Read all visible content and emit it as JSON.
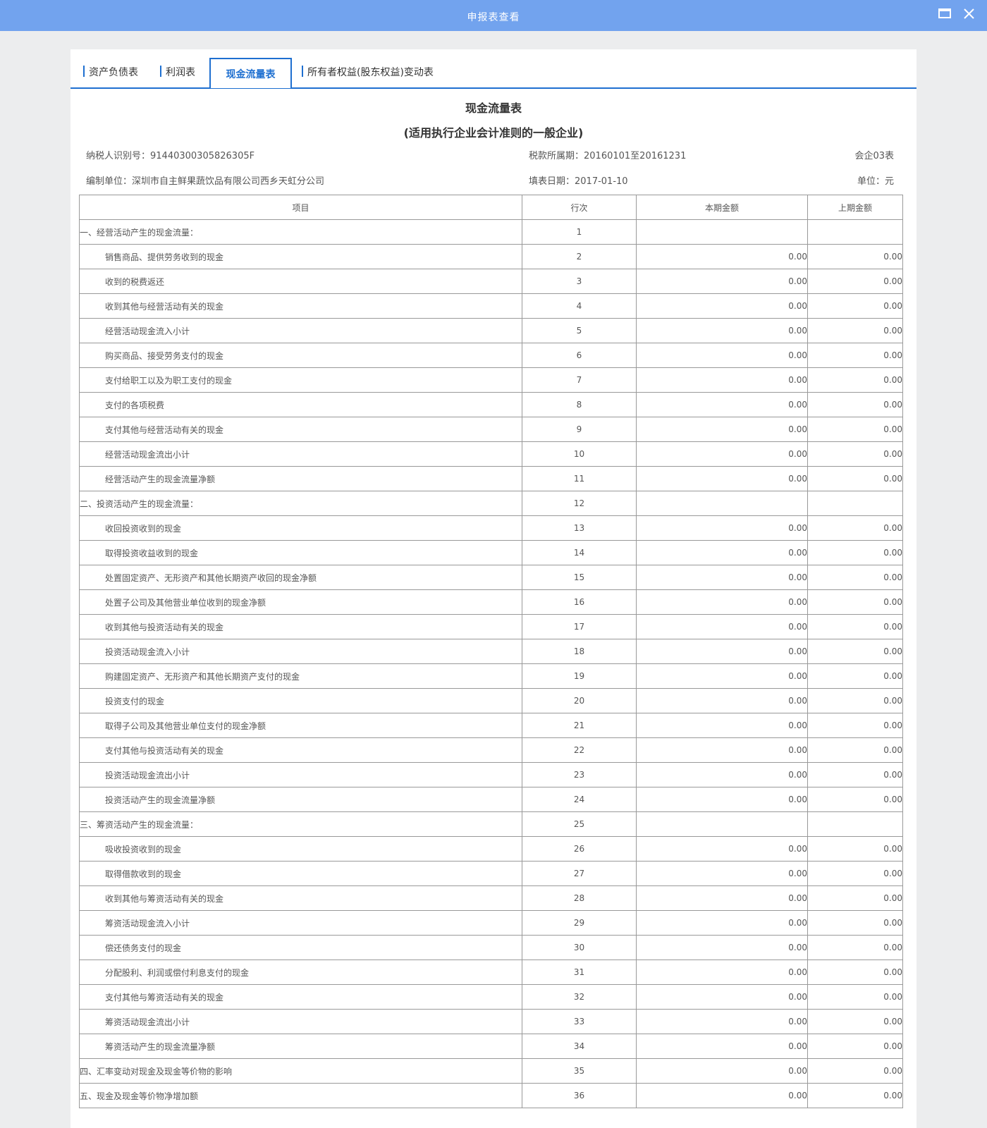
{
  "window": {
    "title": "申报表查看"
  },
  "tabs": [
    {
      "label": "资产负债表"
    },
    {
      "label": "利润表"
    },
    {
      "label": "现金流量表"
    },
    {
      "label": "所有者权益(股东权益)变动表"
    }
  ],
  "report": {
    "title": "现金流量表",
    "subtitle": "(适用执行企业会计准则的一般企业)",
    "taxpayer_id": "纳税人识别号：91440300305826305F",
    "period": "税款所属期：20160101至20161231",
    "form_code": "会企03表",
    "org": "编制单位：深圳市自主鲜果蔬饮品有限公司西乡天虹分公司",
    "fill_date": "填表日期：2017-01-10",
    "unit": "单位：元"
  },
  "table": {
    "headers": {
      "item": "项目",
      "line": "行次",
      "current": "本期金额",
      "previous": "上期金额"
    },
    "rows": [
      {
        "item": "一、经营活动产生的现金流量：",
        "line": "1",
        "current": "",
        "previous": "",
        "section": true
      },
      {
        "item": "销售商品、提供劳务收到的现金",
        "line": "2",
        "current": "0.00",
        "previous": "0.00"
      },
      {
        "item": "收到的税费返还",
        "line": "3",
        "current": "0.00",
        "previous": "0.00"
      },
      {
        "item": "收到其他与经营活动有关的现金",
        "line": "4",
        "current": "0.00",
        "previous": "0.00"
      },
      {
        "item": "经营活动现金流入小计",
        "line": "5",
        "current": "0.00",
        "previous": "0.00"
      },
      {
        "item": "购买商品、接受劳务支付的现金",
        "line": "6",
        "current": "0.00",
        "previous": "0.00"
      },
      {
        "item": "支付给职工以及为职工支付的现金",
        "line": "7",
        "current": "0.00",
        "previous": "0.00"
      },
      {
        "item": "支付的各项税费",
        "line": "8",
        "current": "0.00",
        "previous": "0.00"
      },
      {
        "item": "支付其他与经营活动有关的现金",
        "line": "9",
        "current": "0.00",
        "previous": "0.00"
      },
      {
        "item": "经营活动现金流出小计",
        "line": "10",
        "current": "0.00",
        "previous": "0.00"
      },
      {
        "item": "经营活动产生的现金流量净额",
        "line": "11",
        "current": "0.00",
        "previous": "0.00"
      },
      {
        "item": "二、投资活动产生的现金流量：",
        "line": "12",
        "current": "",
        "previous": "",
        "section": true
      },
      {
        "item": "收回投资收到的现金",
        "line": "13",
        "current": "0.00",
        "previous": "0.00"
      },
      {
        "item": "取得投资收益收到的现金",
        "line": "14",
        "current": "0.00",
        "previous": "0.00"
      },
      {
        "item": "处置固定资产、无形资产和其他长期资产收回的现金净额",
        "line": "15",
        "current": "0.00",
        "previous": "0.00"
      },
      {
        "item": "处置子公司及其他营业单位收到的现金净额",
        "line": "16",
        "current": "0.00",
        "previous": "0.00"
      },
      {
        "item": "收到其他与投资活动有关的现金",
        "line": "17",
        "current": "0.00",
        "previous": "0.00"
      },
      {
        "item": "投资活动现金流入小计",
        "line": "18",
        "current": "0.00",
        "previous": "0.00"
      },
      {
        "item": "购建固定资产、无形资产和其他长期资产支付的现金",
        "line": "19",
        "current": "0.00",
        "previous": "0.00"
      },
      {
        "item": "投资支付的现金",
        "line": "20",
        "current": "0.00",
        "previous": "0.00"
      },
      {
        "item": "取得子公司及其他营业单位支付的现金净额",
        "line": "21",
        "current": "0.00",
        "previous": "0.00"
      },
      {
        "item": "支付其他与投资活动有关的现金",
        "line": "22",
        "current": "0.00",
        "previous": "0.00"
      },
      {
        "item": "投资活动现金流出小计",
        "line": "23",
        "current": "0.00",
        "previous": "0.00"
      },
      {
        "item": "投资活动产生的现金流量净额",
        "line": "24",
        "current": "0.00",
        "previous": "0.00"
      },
      {
        "item": "三、筹资活动产生的现金流量：",
        "line": "25",
        "current": "",
        "previous": "",
        "section": true
      },
      {
        "item": "吸收投资收到的现金",
        "line": "26",
        "current": "0.00",
        "previous": "0.00"
      },
      {
        "item": "取得借款收到的现金",
        "line": "27",
        "current": "0.00",
        "previous": "0.00"
      },
      {
        "item": "收到其他与筹资活动有关的现金",
        "line": "28",
        "current": "0.00",
        "previous": "0.00"
      },
      {
        "item": "筹资活动现金流入小计",
        "line": "29",
        "current": "0.00",
        "previous": "0.00"
      },
      {
        "item": "偿还债务支付的现金",
        "line": "30",
        "current": "0.00",
        "previous": "0.00"
      },
      {
        "item": "分配股利、利润或偿付利息支付的现金",
        "line": "31",
        "current": "0.00",
        "previous": "0.00"
      },
      {
        "item": "支付其他与筹资活动有关的现金",
        "line": "32",
        "current": "0.00",
        "previous": "0.00"
      },
      {
        "item": "筹资活动现金流出小计",
        "line": "33",
        "current": "0.00",
        "previous": "0.00"
      },
      {
        "item": "筹资活动产生的现金流量净额",
        "line": "34",
        "current": "0.00",
        "previous": "0.00"
      },
      {
        "item": "四、汇率变动对现金及现金等价物的影响",
        "line": "35",
        "current": "0.00",
        "previous": "0.00",
        "section": true
      },
      {
        "item": "五、现金及现金等价物净增加额",
        "line": "36",
        "current": "0.00",
        "previous": "0.00",
        "section": true
      }
    ]
  },
  "colors": {
    "titlebar": "#72a3ee",
    "accent": "#1e6fd0",
    "background": "#ecedee"
  },
  "icons": {
    "maximize": "maximize-icon",
    "close": "close-icon"
  }
}
